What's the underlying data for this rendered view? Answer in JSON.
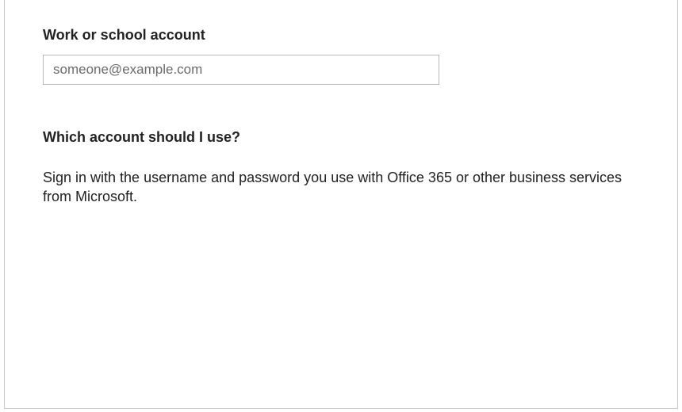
{
  "account": {
    "label": "Work or school account",
    "placeholder": "someone@example.com",
    "value": ""
  },
  "help": {
    "heading": "Which account should I use?",
    "body": "Sign in with the username and password you use with Office 365 or other business services from Microsoft."
  }
}
